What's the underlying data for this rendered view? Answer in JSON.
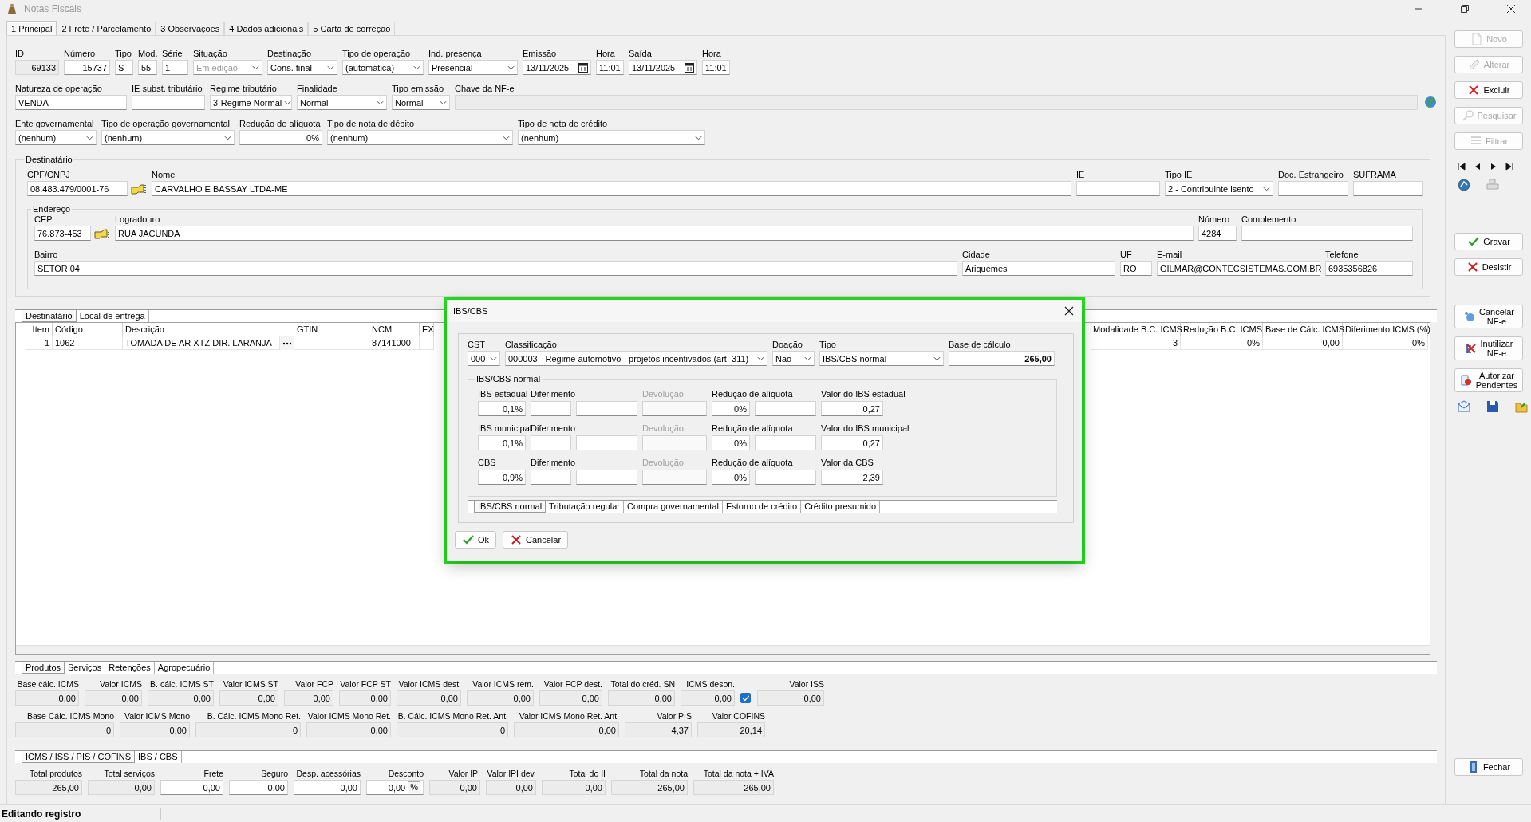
{
  "window": {
    "title": "Notas Fiscais"
  },
  "tabs": [
    {
      "hotkey": "1",
      "label": "Principal",
      "selected": true
    },
    {
      "hotkey": "2",
      "label": "Frete / Parcelamento",
      "selected": false
    },
    {
      "hotkey": "3",
      "label": "Observações",
      "selected": false
    },
    {
      "hotkey": "4",
      "label": "Dados adicionais",
      "selected": false
    },
    {
      "hotkey": "5",
      "label": "Carta de correção",
      "selected": false
    }
  ],
  "header_fields": [
    [
      {
        "label": "ID",
        "value": "69133",
        "kind": "readonly"
      },
      {
        "label": "Número",
        "value": "15737",
        "kind": "number"
      },
      {
        "label": "Tipo",
        "value": "S",
        "kind": "text"
      },
      {
        "label": "Mod.",
        "value": "55",
        "kind": "text"
      },
      {
        "label": "Série",
        "value": "1",
        "kind": "text"
      },
      {
        "label": "Situação",
        "value": "Em edição",
        "kind": "locked_combo"
      },
      {
        "label": "Destinação",
        "value": "Cons. final",
        "kind": "combo"
      },
      {
        "label": "Tipo de operação",
        "value": "(automática)",
        "kind": "combo"
      },
      {
        "label": "Ind. presença",
        "value": "Presencial",
        "kind": "combo"
      },
      {
        "label": "Emissão",
        "value": "13/11/2025",
        "kind": "date"
      },
      {
        "label": "Hora",
        "value": "11:01",
        "kind": "text"
      },
      {
        "label": "Saída",
        "value": "13/11/2025",
        "kind": "date"
      },
      {
        "label": "Hora",
        "value": "11:01",
        "kind": "text"
      }
    ],
    [
      {
        "label": "Natureza de operação",
        "value": "VENDA",
        "kind": "text"
      },
      {
        "label": "IE subst. tributário",
        "kind": "text"
      },
      {
        "label": "Regime tributário",
        "value": "3-Regime Normal",
        "kind": "combo"
      },
      {
        "label": "Finalidade",
        "value": "Normal",
        "kind": "combo"
      },
      {
        "label": "Tipo emissão",
        "value": "Normal",
        "kind": "combo"
      },
      {
        "label": "Chave da NF-e",
        "kind": "readonly"
      }
    ],
    [
      {
        "label": "Ente governamental",
        "value": "(nenhum)",
        "kind": "combo"
      },
      {
        "label": "Tipo de operação governamental",
        "value": "(nenhum)",
        "kind": "combo"
      },
      {
        "label": "Redução de alíquota",
        "value": "0%",
        "kind": "number"
      },
      {
        "label": "Tipo de nota de débito",
        "value": "(nenhum)",
        "kind": "combo"
      },
      {
        "label": "Tipo de nota de crédito",
        "value": "(nenhum)",
        "kind": "combo"
      }
    ]
  ],
  "recipient": {
    "title": "Destinatário",
    "fields": [
      {
        "label": "CPF/CNPJ",
        "value": "08.483.479/0001-76",
        "kind": "lookup"
      },
      {
        "label": "Nome",
        "value": "CARVALHO E BASSAY LTDA-ME",
        "kind": "text"
      },
      {
        "label": "IE",
        "kind": "text"
      },
      {
        "label": "Tipo IE",
        "value": "2 - Contribuinte isento",
        "kind": "combo"
      },
      {
        "label": "Doc. Estrangeiro",
        "kind": "text"
      },
      {
        "label": "SUFRAMA",
        "kind": "text"
      }
    ],
    "address": {
      "title": "Endereço",
      "rows": [
        {
          "fields": [
            {
              "label": "CEP",
              "value": "76.873-453",
              "kind": "lookup"
            },
            {
              "label": "Logradouro",
              "value": "RUA JACUNDA",
              "kind": "text"
            },
            {
              "label": "Número",
              "value": "4284",
              "kind": "text"
            },
            {
              "label": "Complemento",
              "kind": "text"
            }
          ]
        },
        {
          "fields": [
            {
              "label": "Bairro",
              "value": "SETOR 04",
              "kind": "text"
            },
            {
              "label": "Cidade",
              "value": "Ariquemes",
              "kind": "text"
            },
            {
              "label": "UF",
              "value": "RO",
              "kind": "text"
            },
            {
              "label": "E-mail",
              "value": "GILMAR@CONTECSISTEMAS.COM.BR",
              "kind": "text"
            },
            {
              "label": "Telefone",
              "value": "6935356826",
              "kind": "text"
            }
          ]
        }
      ]
    }
  },
  "detail_tabs": [
    {
      "label": "Destinatário",
      "selected": true
    },
    {
      "label": "Local de entrega",
      "selected": false
    }
  ],
  "items_table": {
    "columns": [
      "Item",
      "Código",
      "Descrição",
      "GTIN",
      "NCM",
      "EX",
      "Modalidade B.C. ICMS",
      "Redução B.C. ICMS",
      "Base de Cálc. ICMS",
      "Diferimento ICMS (%)"
    ],
    "rows": [
      [
        "1",
        "1062",
        "TOMADA DE AR XTZ DIR. LARANJA",
        null,
        "87141000",
        null,
        "3",
        "0%",
        "0,00",
        "0%"
      ]
    ]
  },
  "totals_tabs": [
    {
      "label": "Produtos",
      "selected": true
    },
    {
      "label": "Serviços",
      "selected": false
    },
    {
      "label": "Retenções",
      "selected": false
    },
    {
      "label": "Agropecuário",
      "selected": false
    }
  ],
  "totals": [
    [
      {
        "label": "Base cálc. ICMS",
        "value": "0,00",
        "kind": "total"
      },
      {
        "label": "Valor ICMS",
        "value": "0,00",
        "kind": "total"
      },
      {
        "label": "B. cálc. ICMS ST",
        "value": "0,00",
        "kind": "total"
      },
      {
        "label": "Valor ICMS ST",
        "value": "0,00",
        "kind": "total"
      },
      {
        "label": "Valor FCP",
        "value": "0,00",
        "kind": "total"
      },
      {
        "label": "Valor FCP ST",
        "value": "0,00",
        "kind": "total"
      },
      {
        "label": "Valor ICMS dest.",
        "value": "0,00",
        "kind": "total"
      },
      {
        "label": "Valor ICMS rem.",
        "value": "0,00",
        "kind": "total"
      },
      {
        "label": "Valor FCP dest.",
        "value": "0,00",
        "kind": "total"
      },
      {
        "label": "Total do créd. SN",
        "value": "0,00",
        "kind": "total"
      },
      {
        "label": "ICMS deson.",
        "value": "0,00",
        "kind": "total"
      },
      {
        "kind": "checkbox",
        "checked": true
      },
      {
        "label": "Valor ISS",
        "value": "0,00",
        "kind": "total"
      }
    ],
    [
      {
        "label": "Base Cálc. ICMS Mono",
        "value": "0",
        "kind": "total"
      },
      {
        "label": "Valor ICMS Mono",
        "value": "0,00",
        "kind": "total"
      },
      {
        "label": "B. Cálc. ICMS Mono Ret.",
        "value": "0",
        "kind": "total"
      },
      {
        "label": "Valor ICMS Mono Ret.",
        "value": "0,00",
        "kind": "total"
      },
      {
        "label": "B. Cálc. ICMS Mono Ret. Ant.",
        "value": "0",
        "kind": "total"
      },
      {
        "label": "Valor ICMS Mono Ret. Ant.",
        "value": "0,00",
        "kind": "total"
      },
      {
        "label": "Valor PIS",
        "value": "4,37",
        "kind": "total"
      },
      {
        "label": "Valor COFINS",
        "value": "20,14",
        "kind": "total"
      }
    ]
  ],
  "tax_tabs": [
    {
      "label": "ICMS / ISS / PIS / COFINS",
      "selected": true
    },
    {
      "label": "IBS / CBS",
      "selected": false
    }
  ],
  "summary": [
    {
      "label": "Total produtos",
      "value": "265,00",
      "kind": "total"
    },
    {
      "label": "Total serviços",
      "value": "0,00",
      "kind": "total"
    },
    {
      "label": "Frete",
      "value": "0,00",
      "kind": "number"
    },
    {
      "label": "Seguro",
      "value": "0,00",
      "kind": "number"
    },
    {
      "label": "Desp. acessórias",
      "value": "0,00",
      "kind": "number"
    },
    {
      "label": "Desconto",
      "value": "0,00",
      "kind": "percent",
      "button": "%"
    },
    {
      "label": "Valor IPI",
      "value": "0,00",
      "kind": "total"
    },
    {
      "label": "Valor IPI dev.",
      "value": "0,00",
      "kind": "total"
    },
    {
      "label": "Total do II",
      "value": "0,00",
      "kind": "total"
    },
    {
      "label": "Total da nota",
      "value": "265,00",
      "kind": "total"
    },
    {
      "label": "Total da nota + IVA",
      "value": "265,00",
      "kind": "total"
    }
  ],
  "sidebar": {
    "record_buttons": [
      {
        "label": "Novo",
        "disabled": true
      },
      {
        "label": "Alterar",
        "disabled": true
      },
      {
        "label": "Excluir",
        "disabled": false
      },
      {
        "label": "Pesquisar",
        "disabled": true
      },
      {
        "label": "Filtrar",
        "disabled": true
      }
    ],
    "edit_buttons": [
      {
        "label": "Gravar",
        "disabled": false
      },
      {
        "label": "Desistir",
        "disabled": false
      }
    ],
    "nfe_buttons": [
      {
        "label": "Cancelar\nNF-e",
        "disabled": false
      },
      {
        "label": "Inutilizar\nNF-e",
        "disabled": false
      },
      {
        "label": "Autorizar\nPendentes",
        "disabled": false
      }
    ],
    "close_button": {
      "label": "Fechar"
    }
  },
  "dialog": {
    "title": "IBS/CBS",
    "top_fields": [
      {
        "label": "CST",
        "value": "000",
        "kind": "combo"
      },
      {
        "label": "Classificação",
        "value": "000003 - Regime automotivo - projetos incentivados (art. 311)",
        "kind": "combo"
      },
      {
        "label": "Doação",
        "value": "Não",
        "kind": "combo"
      },
      {
        "label": "Tipo",
        "value": "IBS/CBS normal",
        "kind": "combo"
      },
      {
        "label": "Base de cálculo",
        "value": "265,00",
        "kind": "emphasized"
      }
    ],
    "group": {
      "title": "IBS/CBS normal",
      "rows": [
        {
          "tax": "IBS estadual",
          "rate": "0,1%",
          "deferral_label": "Diferimento",
          "refund_label": "Devolução",
          "refund_disabled": true,
          "reduction_label": "Redução de alíquota",
          "reduction": "0%",
          "amount_label": "Valor do IBS estadual",
          "amount": "0,27"
        },
        {
          "tax": "IBS municipal",
          "rate": "0,1%",
          "deferral_label": "Diferimento",
          "refund_label": "Devolução",
          "refund_disabled": true,
          "reduction_label": "Redução de alíquota",
          "reduction": "0%",
          "amount_label": "Valor do IBS municipal",
          "amount": "0,27"
        },
        {
          "tax": "CBS",
          "rate": "0,9%",
          "deferral_label": "Diferimento",
          "refund_label": "Devolução",
          "refund_disabled": true,
          "reduction_label": "Redução de alíquota",
          "reduction": "0%",
          "amount_label": "Valor da CBS",
          "amount": "2,39"
        }
      ]
    },
    "tabs": [
      {
        "label": "IBS/CBS normal",
        "selected": true
      },
      {
        "label": "Tributação regular",
        "selected": false
      },
      {
        "label": "Compra governamental",
        "selected": false
      },
      {
        "label": "Estorno de crédito",
        "selected": false
      },
      {
        "label": "Crédito presumido",
        "selected": false
      }
    ],
    "buttons": [
      {
        "label": "Ok"
      },
      {
        "label": "Cancelar"
      }
    ]
  },
  "status_bar": {
    "text": "Editando registro"
  }
}
